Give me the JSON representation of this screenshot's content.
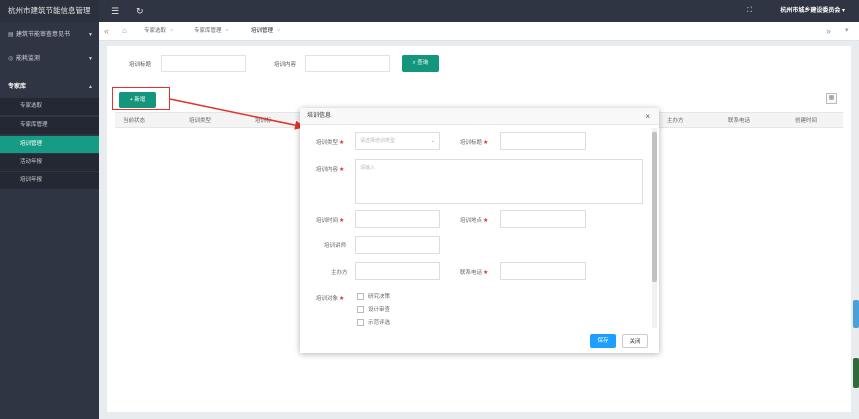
{
  "app": {
    "title": "杭州市建筑节能信息管理"
  },
  "sidebar": {
    "menus": [
      {
        "label": "建筑节能审查意见书",
        "icon": "document-icon"
      },
      {
        "label": "能耗监测",
        "icon": "monitor-icon"
      },
      {
        "label": "专家库",
        "icon": ""
      }
    ],
    "items": [
      {
        "label": "专家选取"
      },
      {
        "label": "专家库管理"
      },
      {
        "label": "培训管理"
      },
      {
        "label": "活动年报"
      },
      {
        "label": "培训年报"
      }
    ]
  },
  "topbar": {
    "org": "杭州市城乡建设委员会 ▾"
  },
  "tabs": [
    {
      "label": "专家选取"
    },
    {
      "label": "专家库管理"
    },
    {
      "label": "培训管理"
    }
  ],
  "filters": {
    "title_label": "培训标题",
    "content_label": "培训内容",
    "search_label": "查询"
  },
  "toolbar": {
    "add_label": "新增"
  },
  "table": {
    "columns": [
      "当前状态",
      "培训类型",
      "培训标",
      "主办方",
      "联系电话",
      "创建时间"
    ]
  },
  "modal": {
    "title": "培训信息",
    "type_label": "培训类型",
    "type_placeholder": "请选择培训类型",
    "title_label": "培训标题",
    "content_label": "培训内容",
    "content_placeholder": "请输入",
    "time_label": "培训时间",
    "place_label": "培训地点",
    "lecturer_label": "培训讲师",
    "organizer_label": "主办方",
    "phone_label": "联系电话",
    "target_label": "培训对象",
    "targets": [
      "研究决策",
      "设计审查",
      "示范评选"
    ],
    "save_label": "保存",
    "close_label": "关闭"
  },
  "colors": {
    "sidebar": "#2f3543",
    "accent": "#13967c",
    "primary": "#1e9fff",
    "highlight": "#e0332a"
  }
}
